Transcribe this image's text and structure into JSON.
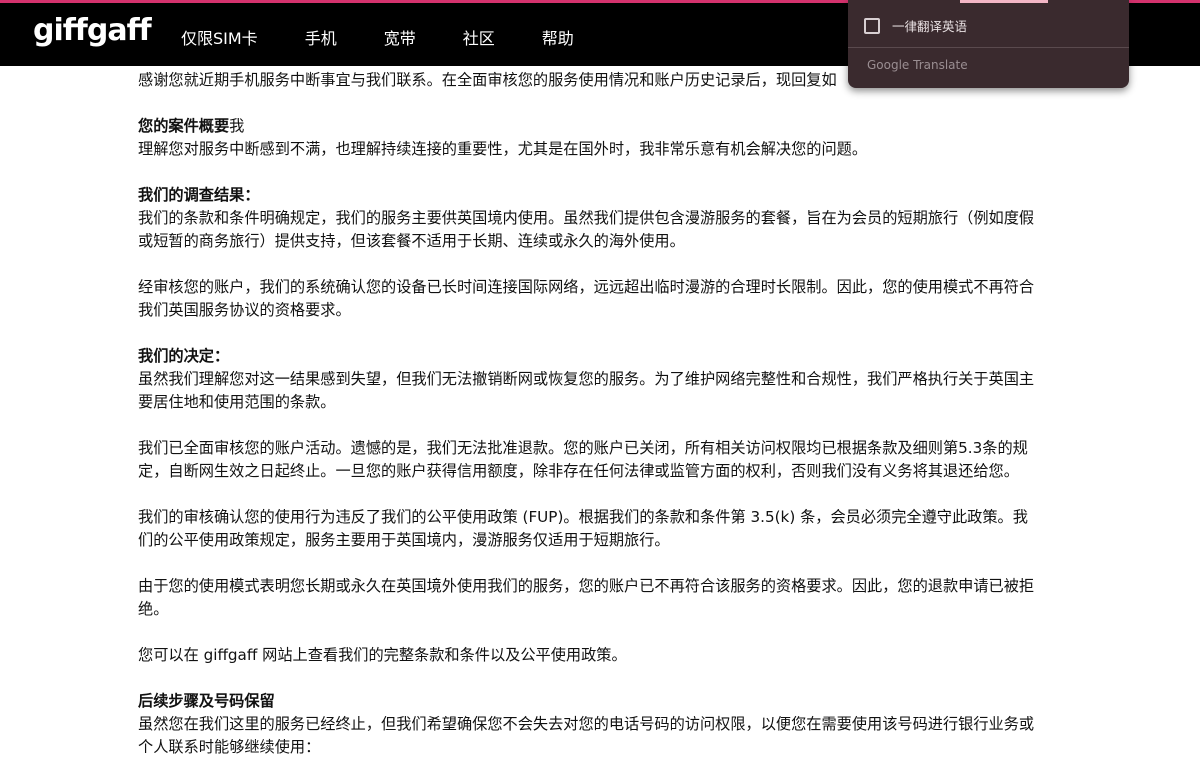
{
  "header": {
    "logo": "giffgaff",
    "nav": [
      "仅限SIM卡",
      "手机",
      "宽带",
      "社区",
      "帮助"
    ],
    "accent_color": "#d4326d"
  },
  "translate_popup": {
    "checkbox_label": "一律翻译英语",
    "brand": "Google Translate"
  },
  "content": {
    "intro_partial": "感谢您就近期手机服务中断事宜与我们联系。在全面审核您的服务使用情况和账户历史记录后，现回复如",
    "summary_heading": "您的案件概要",
    "summary_heading_suffix": "我",
    "summary_text": "理解您对服务中断感到不满，也理解持续连接的重要性，尤其是在国外时，我非常乐意有机会解决您的问题。",
    "findings_heading": "我们的调查结果：",
    "findings_p1": "我们的条款和条件明确规定，我们的服务主要供英国境内使用。虽然我们提供包含漫游服务的套餐，旨在为会员的短期旅行（例如度假或短暂的商务旅行）提供支持，但该套餐不适用于长期、连续或永久的海外使用。",
    "findings_p2": "经审核您的账户，我们的系统确认您的设备已长时间连接国际网络，远远超出临时漫游的合理时长限制。因此，您的使用模式不再符合我们英国服务协议的资格要求。",
    "decision_heading": "我们的决定：",
    "decision_p1": "虽然我们理解您对这一结果感到失望，但我们无法撤销断网或恢复您的服务。为了维护网络完整性和合规性，我们严格执行关于英国主要居住地和使用范围的条款。",
    "decision_p2": "我们已全面审核您的账户活动。遗憾的是，我们无法批准退款。您的账户已关闭，所有相关访问权限均已根据条款及细则第5.3条的规定，自断网生效之日起终止。一旦您的账户获得信用额度，除非存在任何法律或监管方面的权利，否则我们没有义务将其退还给您。",
    "decision_p3": "我们的审核确认您的使用行为违反了我们的公平使用政策 (FUP)。根据我们的条款和条件第 3.5(k) 条，会员必须完全遵守此政策。我们的公平使用政策规定，服务主要用于英国境内，漫游服务仅适用于短期旅行。",
    "decision_p4": "由于您的使用模式表明您长期或永久在英国境外使用我们的服务，您的账户已不再符合该服务的资格要求。因此，您的退款申请已被拒绝。",
    "decision_p5": "您可以在 giffgaff 网站上查看我们的完整条款和条件以及公平使用政策。",
    "next_heading": "后续步骤及号码保留",
    "next_p1": "虽然您在我们这里的服务已经终止，但我们希望确保您不会失去对您的电话号码的访问权限，以便您在需要使用该号码进行银行业务或个人联系时能够继续使用："
  }
}
